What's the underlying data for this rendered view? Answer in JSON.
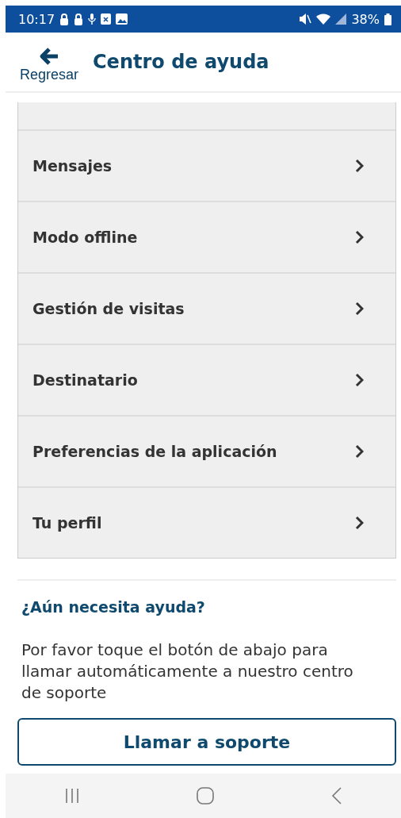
{
  "status_bar": {
    "time": "10:17",
    "battery": "38%"
  },
  "header": {
    "back_label": "Regresar",
    "title": "Centro de ayuda"
  },
  "topics": [
    {
      "label": "Mensajes"
    },
    {
      "label": "Modo offline"
    },
    {
      "label": "Gestión de visitas"
    },
    {
      "label": "Destinatario"
    },
    {
      "label": "Preferencias de la aplicación"
    },
    {
      "label": "Tu perfil"
    }
  ],
  "help": {
    "heading": "¿Aún necesita ayuda?",
    "text": "Por favor toque el botón de abajo para llamar automáticamente a nuestro centro de soporte",
    "button": "Llamar a soporte"
  }
}
